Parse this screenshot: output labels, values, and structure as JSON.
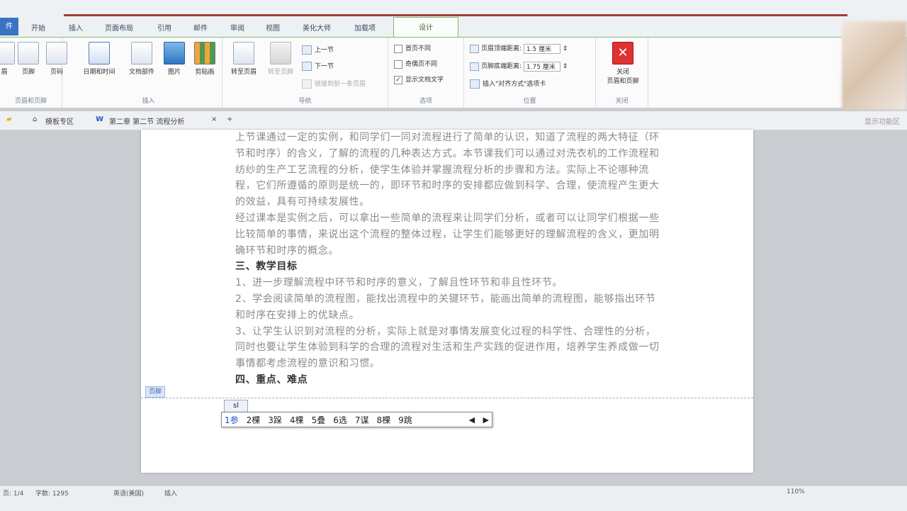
{
  "ribbon_tabs": {
    "file": "件",
    "items": [
      "开始",
      "插入",
      "页面布局",
      "引用",
      "邮件",
      "审阅",
      "视图",
      "美化大师",
      "加载项"
    ],
    "active": "设计"
  },
  "groups": {
    "header_footer": {
      "label": "页眉和页脚",
      "buttons": [
        "眉",
        "页脚",
        "页码"
      ]
    },
    "insert": {
      "label": "插入",
      "buttons": [
        "日期和时间",
        "文档部件",
        "图片",
        "剪贴画"
      ]
    },
    "navigation": {
      "label": "导航",
      "goto_header": "转至页眉",
      "goto_footer": "转至页脚",
      "previous": "上一节",
      "next": "下一节",
      "link_previous": "链接到前一条页眉"
    },
    "options": {
      "label": "选项",
      "different_first_page": "首页不同",
      "different_odd_even": "奇偶页不同",
      "show_document_text": "显示文档文字"
    },
    "position": {
      "label": "位置",
      "header_from_top_label": "页眉顶端距离:",
      "header_from_top_value": "1.5 厘米",
      "footer_from_bottom_label": "页脚底端距离:",
      "footer_from_bottom_value": "1.75 厘米",
      "insert_alignment_tab": "插入\"对齐方式\"选项卡"
    },
    "close": {
      "label": "关闭",
      "button": "关闭\n页眉和页脚"
    }
  },
  "docbar": {
    "template_area": "模板专区",
    "doc_title": "第二章 第二节 流程分析",
    "tab_close": "×",
    "tab_add": "+",
    "right_text": "显示功能区"
  },
  "document": {
    "paragraphs": [
      "上节课通过一定的实例，和同学们一同对流程进行了简单的认识，知道了流程的两大特征（环节和时序）的含义，了解的流程的几种表达方式。本节课我们可以通过对洗衣机的工作流程和纺纱的生产工艺流程的分析，使学生体验并掌握流程分析的步骤和方法。实际上不论哪种流程，它们所遵循的原则是统一的，即环节和时序的安排都应做到科学、合理，使流程产生更大的效益，具有可持续发展性。",
      "经过课本是实例之后，可以拿出一些简单的流程来让同学们分析，或者可以让同学们根据一些比较简单的事情，来说出这个流程的整体过程，让学生们能够更好的理解流程的含义，更加明确环节和时序的概念。"
    ],
    "heading3": "三、教学目标",
    "goals": [
      "1、进一步理解流程中环节和时序的意义，了解且性环节和非且性环节。",
      "2、学会阅读简单的流程图，能找出流程中的关键环节，能画出简单的流程图，能够指出环节和时序在安排上的优缺点。",
      "3、让学生认识到对流程的分析，实际上就是对事情发展变化过程的科学性、合理性的分析，同时也要让学生体验到科学的合理的流程对生活和生产实践的促进作用，培养学生养成做一切事情都考虑流程的意识和习惯。"
    ],
    "heading4": "四、重点、难点",
    "footer_tag": "页脚",
    "ime_input": "sl",
    "ime_candidates": [
      "1参",
      "2棵",
      "3跺",
      "4棵",
      "5叠",
      "6选",
      "7谋",
      "8棵",
      "9跳"
    ],
    "ime_nav_prev": "◀",
    "ime_nav_next": "▶"
  },
  "statusbar": {
    "page": "页: 1/4",
    "words": "字数: 1295",
    "lang": "英语(美国)",
    "mode": "插入",
    "zoom": "110%"
  }
}
